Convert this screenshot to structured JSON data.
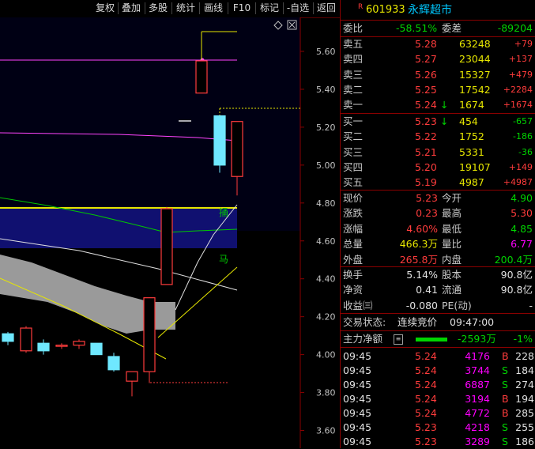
{
  "toolbar": {
    "items": [
      "复权",
      "叠加",
      "多股",
      "统计",
      "画线",
      "F10",
      "标记",
      "-自选",
      "返回"
    ]
  },
  "chart": {
    "yticks": [
      "5.60",
      "5.40",
      "5.20",
      "5.00",
      "4.80",
      "4.60",
      "4.40",
      "4.20",
      "4.00",
      "3.80",
      "3.60"
    ],
    "label_fang": "捅",
    "label_ma": "马",
    "candles": [
      {
        "open": 4.11,
        "high": 4.12,
        "low": 4.05,
        "close": 4.07
      },
      {
        "open": 4.02,
        "high": 4.15,
        "low": 4.01,
        "close": 4.14
      },
      {
        "open": 4.06,
        "high": 4.08,
        "low": 4.0,
        "close": 4.02
      },
      {
        "open": 4.05,
        "high": 4.06,
        "low": 4.03,
        "close": 4.05
      },
      {
        "open": 4.05,
        "high": 4.08,
        "low": 4.03,
        "close": 4.07
      },
      {
        "open": 4.06,
        "high": 4.06,
        "low": 4.01,
        "close": 4.0
      },
      {
        "open": 3.99,
        "high": 4.01,
        "low": 3.91,
        "close": 3.92
      },
      {
        "open": 3.86,
        "high": 3.91,
        "low": 3.78,
        "close": 3.91
      },
      {
        "open": 3.91,
        "high": 4.24,
        "low": 3.85,
        "close": 4.3
      },
      {
        "open": 4.37,
        "high": 4.78,
        "low": 4.37,
        "close": 4.77
      },
      {
        "open": 5.38,
        "high": 5.55,
        "low": 5.38,
        "close": 5.55
      },
      {
        "open": 5.26,
        "high": 5.26,
        "low": 4.96,
        "close": 5.0
      },
      {
        "open": 4.94,
        "high": 5.23,
        "low": 4.84,
        "close": 5.23
      }
    ]
  },
  "panel": {
    "badge": "R",
    "code": "601933",
    "name": "永辉超市",
    "weibi": {
      "label": "委比",
      "value": "-58.51%",
      "label2": "委差",
      "value2": "-89204"
    },
    "sell": [
      {
        "label": "卖五",
        "price": "5.28",
        "vol": "63248",
        "chg": "+79"
      },
      {
        "label": "卖四",
        "price": "5.27",
        "vol": "23044",
        "chg": "+137"
      },
      {
        "label": "卖三",
        "price": "5.26",
        "vol": "15327",
        "chg": "+479"
      },
      {
        "label": "卖二",
        "price": "5.25",
        "vol": "17542",
        "chg": "+2284"
      },
      {
        "label": "卖一",
        "price": "5.24",
        "vol": "1674",
        "chg": "+1674",
        "arrow": "↓"
      }
    ],
    "buy": [
      {
        "label": "买一",
        "price": "5.23",
        "vol": "454",
        "chg": "-657",
        "arrow": "↓"
      },
      {
        "label": "买二",
        "price": "5.22",
        "vol": "1752",
        "chg": "-186"
      },
      {
        "label": "买三",
        "price": "5.21",
        "vol": "5331",
        "chg": "-36"
      },
      {
        "label": "买四",
        "price": "5.20",
        "vol": "19107",
        "chg": "+149"
      },
      {
        "label": "买五",
        "price": "5.19",
        "vol": "4987",
        "chg": "+4987"
      }
    ],
    "quote": [
      {
        "l1": "现价",
        "v1": "5.23",
        "l2": "今开",
        "v2": "4.90"
      },
      {
        "l1": "涨跌",
        "v1": "0.23",
        "l2": "最高",
        "v2": "5.30"
      },
      {
        "l1": "涨幅",
        "v1": "4.60%",
        "l2": "最低",
        "v2": "4.85"
      },
      {
        "l1": "总量",
        "v1": "466.3万",
        "l2": "量比",
        "v2": "6.77"
      },
      {
        "l1": "外盘",
        "v1": "265.8万",
        "l2": "内盘",
        "v2": "200.4万"
      }
    ],
    "fund": [
      {
        "l1": "换手",
        "v1": "5.14%",
        "l2": "股本",
        "v2": "90.8亿"
      },
      {
        "l1": "净资",
        "v1": "0.41",
        "l2": "流通",
        "v2": "90.8亿"
      },
      {
        "l1": "收益㈢",
        "v1": "-0.080",
        "l2": "PE(动)",
        "v2": "-"
      }
    ],
    "status": {
      "label": "交易状态:",
      "value": "连续竞价",
      "time": "09:47:00"
    },
    "mainflow": {
      "label": "主力净额",
      "value": "-2593万",
      "pct": "-1%"
    },
    "ticks": [
      {
        "time": "09:45",
        "price": "5.24",
        "vol": "4176",
        "side": "B",
        "num": "228"
      },
      {
        "time": "09:45",
        "price": "5.24",
        "vol": "3744",
        "side": "S",
        "num": "184"
      },
      {
        "time": "09:45",
        "price": "5.24",
        "vol": "6887",
        "side": "S",
        "num": "274"
      },
      {
        "time": "09:45",
        "price": "5.24",
        "vol": "3194",
        "side": "B",
        "num": "194"
      },
      {
        "time": "09:45",
        "price": "5.24",
        "vol": "4772",
        "side": "B",
        "num": "285"
      },
      {
        "time": "09:45",
        "price": "5.23",
        "vol": "4218",
        "side": "S",
        "num": "255"
      },
      {
        "time": "09:45",
        "price": "5.23",
        "vol": "3289",
        "side": "S",
        "num": "186"
      }
    ],
    "colors": {
      "up": "#ff3c3c",
      "down": "#00d400",
      "bull_fill": "#000000",
      "bear_fill": "#6fe8ff"
    }
  }
}
